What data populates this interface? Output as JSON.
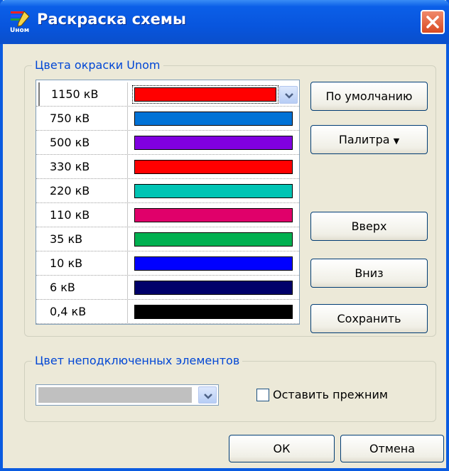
{
  "window": {
    "title": "Раскраска схемы",
    "icon": "app-color-icon",
    "accent": "#0A5BE0"
  },
  "voltage_group": {
    "legend": "Цвета окраски Unom",
    "rows": [
      {
        "label": "1150 кВ",
        "color": "#FF0000"
      },
      {
        "label": "750 кВ",
        "color": "#0072D6"
      },
      {
        "label": "500 кВ",
        "color": "#8000E0"
      },
      {
        "label": "330 кВ",
        "color": "#FF0000"
      },
      {
        "label": "220 кВ",
        "color": "#00C4B4"
      },
      {
        "label": "110 кВ",
        "color": "#E0006A"
      },
      {
        "label": "35 кВ",
        "color": "#00B050"
      },
      {
        "label": "10 кВ",
        "color": "#0000FF"
      },
      {
        "label": "6 кВ",
        "color": "#00006A"
      },
      {
        "label": "0,4 кВ",
        "color": "#000000"
      }
    ]
  },
  "buttons": {
    "default": "По умолчанию",
    "palette": "Палитра",
    "up": "Вверх",
    "down": "Вниз",
    "save": "Сохранить",
    "ok": "ОК",
    "cancel": "Отмена"
  },
  "unconnected_group": {
    "legend": "Цвет неподключенных элементов",
    "selected_color": "#C0C0C0",
    "keep_previous_label": "Оставить прежним",
    "keep_previous_checked": false
  }
}
